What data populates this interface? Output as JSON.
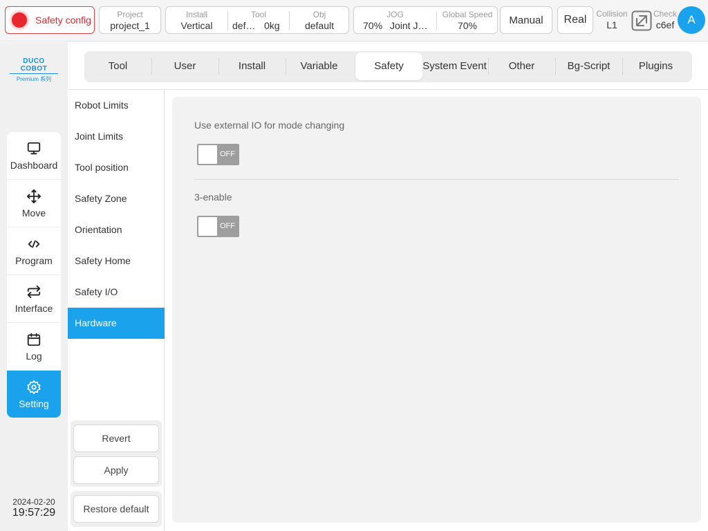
{
  "topbar": {
    "safety_config": "Safety config",
    "project": {
      "label": "Project",
      "value": "project_1"
    },
    "install": {
      "label": "Install",
      "value": "Vertical"
    },
    "tool": {
      "label": "Tool",
      "name": "def…",
      "weight": "0kg"
    },
    "obj": {
      "label": "Obj",
      "value": "default"
    },
    "jog": {
      "label": "JOG",
      "percent": "70%",
      "mode": "Joint J…"
    },
    "global_speed": {
      "label": "Global Speed",
      "value": "70%"
    },
    "manual": "Manual",
    "real": "Real",
    "collision": {
      "label": "Collision",
      "value": "L1"
    },
    "check": {
      "label": "Check",
      "value": "c6ef"
    },
    "avatar": "A",
    "accent_color": "#1aa3ec",
    "alert_color": "#e0262d"
  },
  "logo": {
    "main": "DUCO COBOT",
    "sub": "Premium 系列"
  },
  "nav": {
    "items": [
      {
        "label": "Dashboard",
        "icon": "monitor-icon"
      },
      {
        "label": "Move",
        "icon": "move-arrows-icon"
      },
      {
        "label": "Program",
        "icon": "code-icon"
      },
      {
        "label": "Interface",
        "icon": "swap-arrows-icon"
      },
      {
        "label": "Log",
        "icon": "calendar-icon"
      },
      {
        "label": "Setting",
        "icon": "gear-icon",
        "active": true
      }
    ]
  },
  "datetime": {
    "date": "2024-02-20",
    "time": "19:57:29"
  },
  "tabs": [
    "Tool",
    "User",
    "Install",
    "Variable",
    "Safety",
    "System Event",
    "Other",
    "Bg-Script",
    "Plugins"
  ],
  "active_tab": "Safety",
  "submenu": {
    "items": [
      "Robot Limits",
      "Joint Limits",
      "Tool position",
      "Safety Zone",
      "Orientation",
      "Safety Home",
      "Safety I/O",
      "Hardware"
    ],
    "active": "Hardware",
    "revert": "Revert",
    "apply": "Apply",
    "restore": "Restore default"
  },
  "content": {
    "external_io": {
      "label": "Use external IO for mode changing",
      "state": "OFF"
    },
    "three_enable": {
      "label": "3-enable",
      "state": "OFF"
    }
  }
}
